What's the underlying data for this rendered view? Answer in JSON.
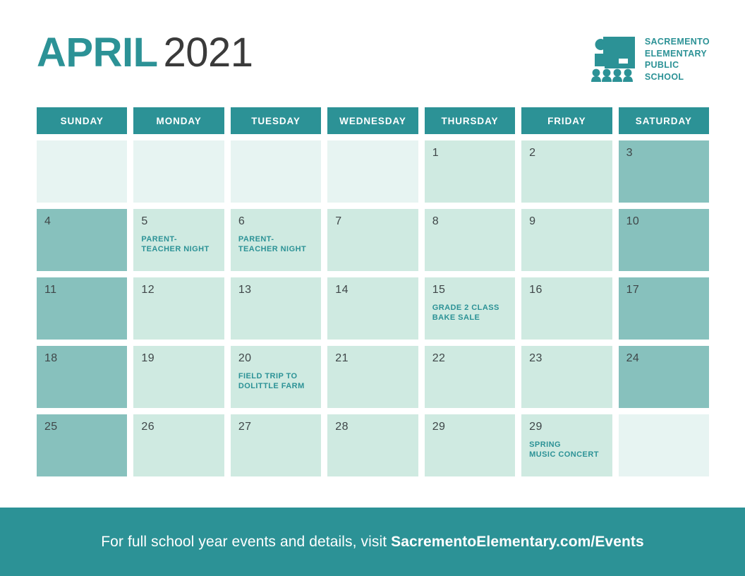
{
  "header": {
    "month": "APRIL",
    "year": "2021",
    "month_color": "#2C9296",
    "year_color": "#3A3A3A",
    "brand": {
      "logo_icon": "classroom-teacher-icon",
      "lines": [
        "SACREMENTO",
        "ELEMENTARY",
        "PUBLIC",
        "SCHOOL"
      ],
      "color": "#2C9296"
    }
  },
  "calendar": {
    "weekdays": [
      "SUNDAY",
      "MONDAY",
      "TUESDAY",
      "WEDNESDAY",
      "THURSDAY",
      "FRIDAY",
      "SATURDAY"
    ],
    "header_bg": "#2C9296",
    "header_text_color": "#FFFFFF",
    "tones": {
      "pale": "#E7F4F2",
      "light": "#CFEAE1",
      "mid": "#87C1BD"
    },
    "weeks": [
      [
        {
          "date": "",
          "event": "",
          "tone": "pale"
        },
        {
          "date": "",
          "event": "",
          "tone": "pale"
        },
        {
          "date": "",
          "event": "",
          "tone": "pale"
        },
        {
          "date": "",
          "event": "",
          "tone": "pale"
        },
        {
          "date": "1",
          "event": "",
          "tone": "light"
        },
        {
          "date": "2",
          "event": "",
          "tone": "light"
        },
        {
          "date": "3",
          "event": "",
          "tone": "mid"
        }
      ],
      [
        {
          "date": "4",
          "event": "",
          "tone": "mid"
        },
        {
          "date": "5",
          "event": "PARENT-\nTEACHER NIGHT",
          "tone": "light"
        },
        {
          "date": "6",
          "event": "PARENT-\nTEACHER NIGHT",
          "tone": "light"
        },
        {
          "date": "7",
          "event": "",
          "tone": "light"
        },
        {
          "date": "8",
          "event": "",
          "tone": "light"
        },
        {
          "date": "9",
          "event": "",
          "tone": "light"
        },
        {
          "date": "10",
          "event": "",
          "tone": "mid"
        }
      ],
      [
        {
          "date": "11",
          "event": "",
          "tone": "mid"
        },
        {
          "date": "12",
          "event": "",
          "tone": "light"
        },
        {
          "date": "13",
          "event": "",
          "tone": "light"
        },
        {
          "date": "14",
          "event": "",
          "tone": "light"
        },
        {
          "date": "15",
          "event": "GRADE 2 CLASS\nBAKE SALE",
          "tone": "light"
        },
        {
          "date": "16",
          "event": "",
          "tone": "light"
        },
        {
          "date": "17",
          "event": "",
          "tone": "mid"
        }
      ],
      [
        {
          "date": "18",
          "event": "",
          "tone": "mid"
        },
        {
          "date": "19",
          "event": "",
          "tone": "light"
        },
        {
          "date": "20",
          "event": "FIELD TRIP TO\nDOLITTLE FARM",
          "tone": "light"
        },
        {
          "date": "21",
          "event": "",
          "tone": "light"
        },
        {
          "date": "22",
          "event": "",
          "tone": "light"
        },
        {
          "date": "23",
          "event": "",
          "tone": "light"
        },
        {
          "date": "24",
          "event": "",
          "tone": "mid"
        }
      ],
      [
        {
          "date": "25",
          "event": "",
          "tone": "mid"
        },
        {
          "date": "26",
          "event": "",
          "tone": "light"
        },
        {
          "date": "27",
          "event": "",
          "tone": "light"
        },
        {
          "date": "28",
          "event": "",
          "tone": "light"
        },
        {
          "date": "29",
          "event": "",
          "tone": "light"
        },
        {
          "date": "29",
          "event": "SPRING\nMUSIC CONCERT",
          "tone": "light"
        },
        {
          "date": "",
          "event": "",
          "tone": "pale"
        }
      ]
    ]
  },
  "footer": {
    "lead_text": "For full school year events and details, visit ",
    "url": "SacrementoElementary.com/Events",
    "bg": "#2C9296",
    "text_color": "#FFFFFF"
  }
}
